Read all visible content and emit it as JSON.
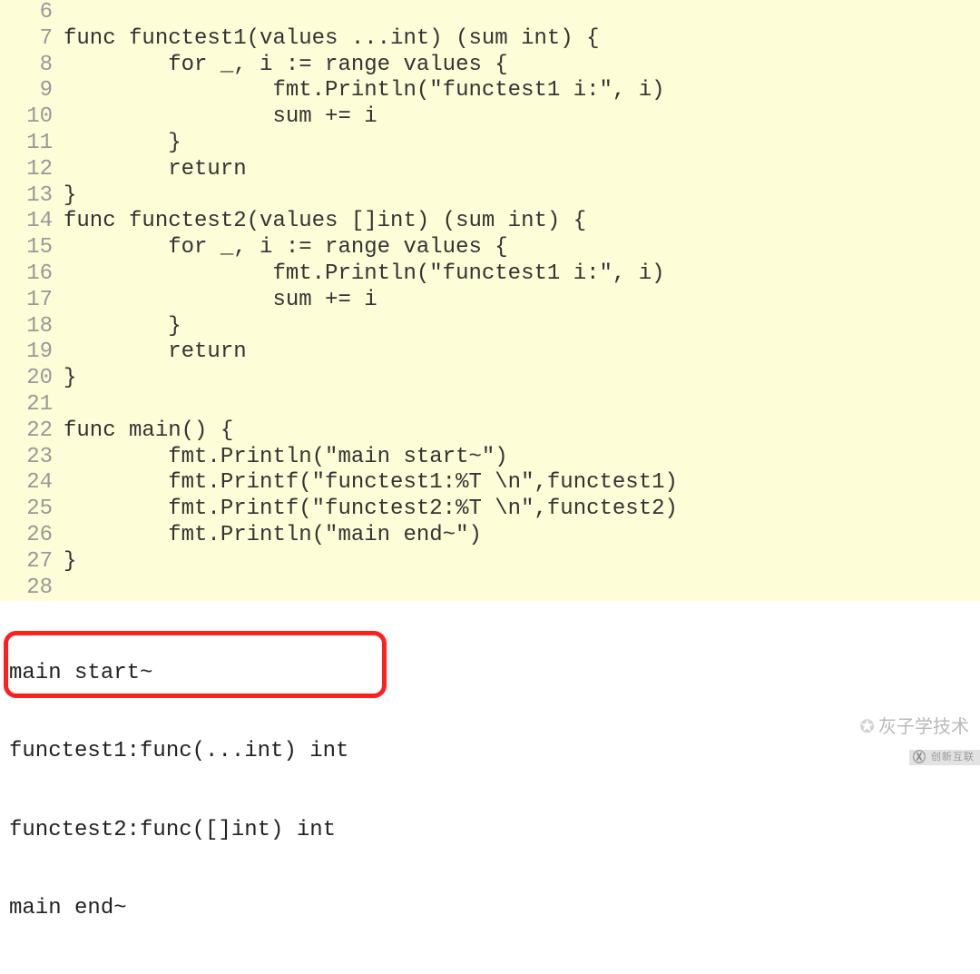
{
  "code": {
    "lines": [
      {
        "n": "6",
        "t": ""
      },
      {
        "n": "7",
        "t": "func functest1(values ...int) (sum int) {"
      },
      {
        "n": "8",
        "t": "        for _, i := range values {"
      },
      {
        "n": "9",
        "t": "                fmt.Println(\"functest1 i:\", i)"
      },
      {
        "n": "10",
        "t": "                sum += i"
      },
      {
        "n": "11",
        "t": "        }"
      },
      {
        "n": "12",
        "t": "        return"
      },
      {
        "n": "13",
        "t": "}"
      },
      {
        "n": "14",
        "t": "func functest2(values []int) (sum int) {"
      },
      {
        "n": "15",
        "t": "        for _, i := range values {"
      },
      {
        "n": "16",
        "t": "                fmt.Println(\"functest1 i:\", i)"
      },
      {
        "n": "17",
        "t": "                sum += i"
      },
      {
        "n": "18",
        "t": "        }"
      },
      {
        "n": "19",
        "t": "        return"
      },
      {
        "n": "20",
        "t": "}"
      },
      {
        "n": "21",
        "t": ""
      },
      {
        "n": "22",
        "t": "func main() {"
      },
      {
        "n": "23",
        "t": "        fmt.Println(\"main start~\")"
      },
      {
        "n": "24",
        "t": "        fmt.Printf(\"functest1:%T \\n\",functest1)"
      },
      {
        "n": "25",
        "t": "        fmt.Printf(\"functest2:%T \\n\",functest2)"
      },
      {
        "n": "26",
        "t": "        fmt.Println(\"main end~\")"
      },
      {
        "n": "27",
        "t": "}"
      },
      {
        "n": "28",
        "t": ""
      }
    ]
  },
  "output": {
    "line1": "main start~",
    "line2": "functest1:func(...int) int",
    "line3": "functest2:func([]int) int",
    "line4": "main end~"
  },
  "watermark": {
    "text": "灰子学技术"
  },
  "brand": {
    "logo": "Ⓧ",
    "text": "创新互联"
  }
}
